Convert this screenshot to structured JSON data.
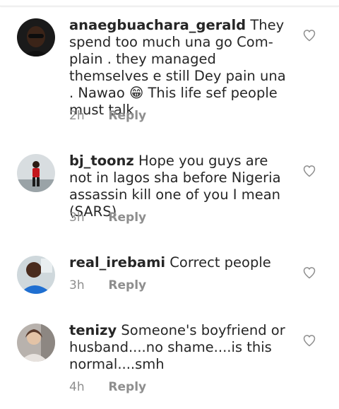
{
  "comments": [
    {
      "username": "anaegbuachara_gerald",
      "text": "They spend too much una go Com-plain . they managed themselves e still Dey pain una . Nawao 😁 This life sef people must talk",
      "time": "2h",
      "reply_label": "Reply",
      "avatar_icon": "avatar-dark-glasses",
      "like_icon": "heart-outline-icon"
    },
    {
      "username": "bj_toonz",
      "text": "Hope you guys are not in lagos sha before Nigeria assassin kill one of you I mean (SARS)",
      "time": "3h",
      "reply_label": "Reply",
      "avatar_icon": "avatar-runner-red",
      "like_icon": "heart-outline-icon"
    },
    {
      "username": "real_irebami",
      "text": "Correct people",
      "time": "3h",
      "reply_label": "Reply",
      "avatar_icon": "avatar-man-blue-shirt",
      "like_icon": "heart-outline-icon"
    },
    {
      "username": "tenizy",
      "text": "Someone's boyfriend  or husband....no shame....is this normal....smh",
      "time": "4h",
      "reply_label": "Reply",
      "avatar_icon": "avatar-woman-gray",
      "like_icon": "heart-outline-icon"
    }
  ],
  "colors": {
    "text": "#262626",
    "secondary": "#8e8e8e",
    "divider": "#e6e6e6"
  }
}
